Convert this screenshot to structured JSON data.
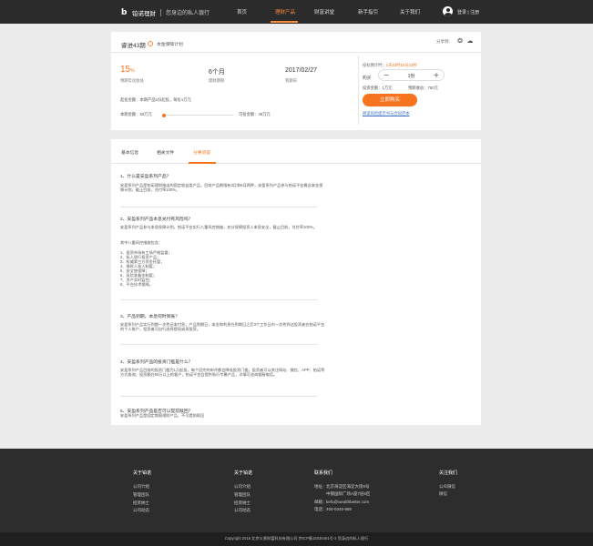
{
  "brand": {
    "name": "铂诺理财",
    "slogan": "您身边的私人银行",
    "logo_icon": "b-logo-mark"
  },
  "nav": {
    "items": [
      "首页",
      "理财产品",
      "财富讲堂",
      "新手指引",
      "关于我们"
    ],
    "active_index": 1,
    "login": "登录 | 注册"
  },
  "product": {
    "title": "睿进43期",
    "plan": "本金保障计划",
    "share_label": "分享到:",
    "rate_value": "15",
    "rate_unit": "%",
    "rate_label": "预期年化收益",
    "term_value": "6个月",
    "term_label": "理财期限",
    "date_value": "2017/02/27",
    "date_label": "到期日",
    "start_info": "起投金额：本期产品1份起投，每份1万元",
    "amount_label": "本期金额：50万元",
    "available_label": "可投金额：49万元",
    "progress": 0.02
  },
  "purchase": {
    "countdown_label": "投标倒计时：",
    "countdown_value": "1天23时15分23秒",
    "buy_label": "购买",
    "minus_symbol": "−",
    "plus_symbol": "+",
    "quantity": "1份",
    "invest_amount": "投资金额：1万元",
    "expected_income": "预期收益：750元",
    "buy_button": "立即购买",
    "risk_link": "阅读风险提示书与合同范本"
  },
  "tabs": {
    "items": [
      "基本信息",
      "相关文件",
      "分惠问答"
    ],
    "active_index": 2
  },
  "faq": [
    {
      "q": "1、什么是安盈系列产品？",
      "p": "安盈系列产品是铂诺理财推出的固定收益类产品，目前产品期限有3月和6月两种，安盈系列产品参与铂诺平台概念本金保障计划，截止目前，兑付率100%。"
    },
    {
      "q": "2、安盈系列产品本息兑付有风险吗？",
      "p": "安盈系列产品参与本息保障计划，铂诺平台实行八重风控措施，充分保障投资人本息安全，截止目前，兑付率100%。",
      "sub": "其中八重风控措施包含：",
      "list": [
        "1、投资市场有工场严格监督；",
        "2、私人银行投资产品；",
        "3、权威第三方资金托管；",
        "4、借款人准入制度；",
        "5、安全垫保障；",
        "6、风险准备金制度；",
        "7、资产实时监控；",
        "8、平台技术保障。"
      ]
    },
    {
      "q": "3、产品到期，本息何时到账？",
      "p": "安盈系列产品实行到期一次性还本付息，产品到期日，本金和利息在到期日之后3个工作日内一次性到达投资者在铂诺平台的个人账户，投资者可自行选择提现或再投资。"
    },
    {
      "q": "4、安盈系列产品的投资门槛是什么？",
      "p": "安盈系列产品目前的投资门槛为1万起投，每个回完的申评都会降低投资门槛，投资者可以关注网站、微信、APP、铂诺等方式查询；投资额在50万以上的客户，铂诺平台会提供私行专属产品，详情可咨询客服电话。"
    },
    {
      "q": "5、安盈系列产品是否可以提前赎回？",
      "p": "安盈系列产品是固定期限理财产品，不可提前赎回"
    }
  ],
  "footer": {
    "col1": {
      "title": "关于铂诺",
      "links": [
        "公司介绍",
        "管理团队",
        "招贤纳士",
        "公司动态"
      ]
    },
    "col2": {
      "title": "关于铂诺",
      "links": [
        "公司介绍",
        "管理团队",
        "招贤纳士",
        "公司动态"
      ]
    },
    "contact": {
      "title": "联系我们",
      "address_label": "地址：",
      "address_1": "北京海淀区海淀大街8号",
      "address_2": "中钢国际广场A座7层6区",
      "email_label": "邮箱：",
      "email": "kefu@wealthbetter.com",
      "phone_label": "电话：",
      "phone": "400-0345-986"
    },
    "follow": {
      "title": "关注我们",
      "links": [
        "公众微信",
        "微信"
      ]
    },
    "copyright": "Copyright 2016 北京义景财富科技有限公司 京ICP备15036491号-2 您身边的私人银行"
  },
  "colors": {
    "accent": "#f7731e",
    "header_bg": "#2b2b2b",
    "footer_bg": "#2d2d2d",
    "link": "#3a6fc4"
  }
}
